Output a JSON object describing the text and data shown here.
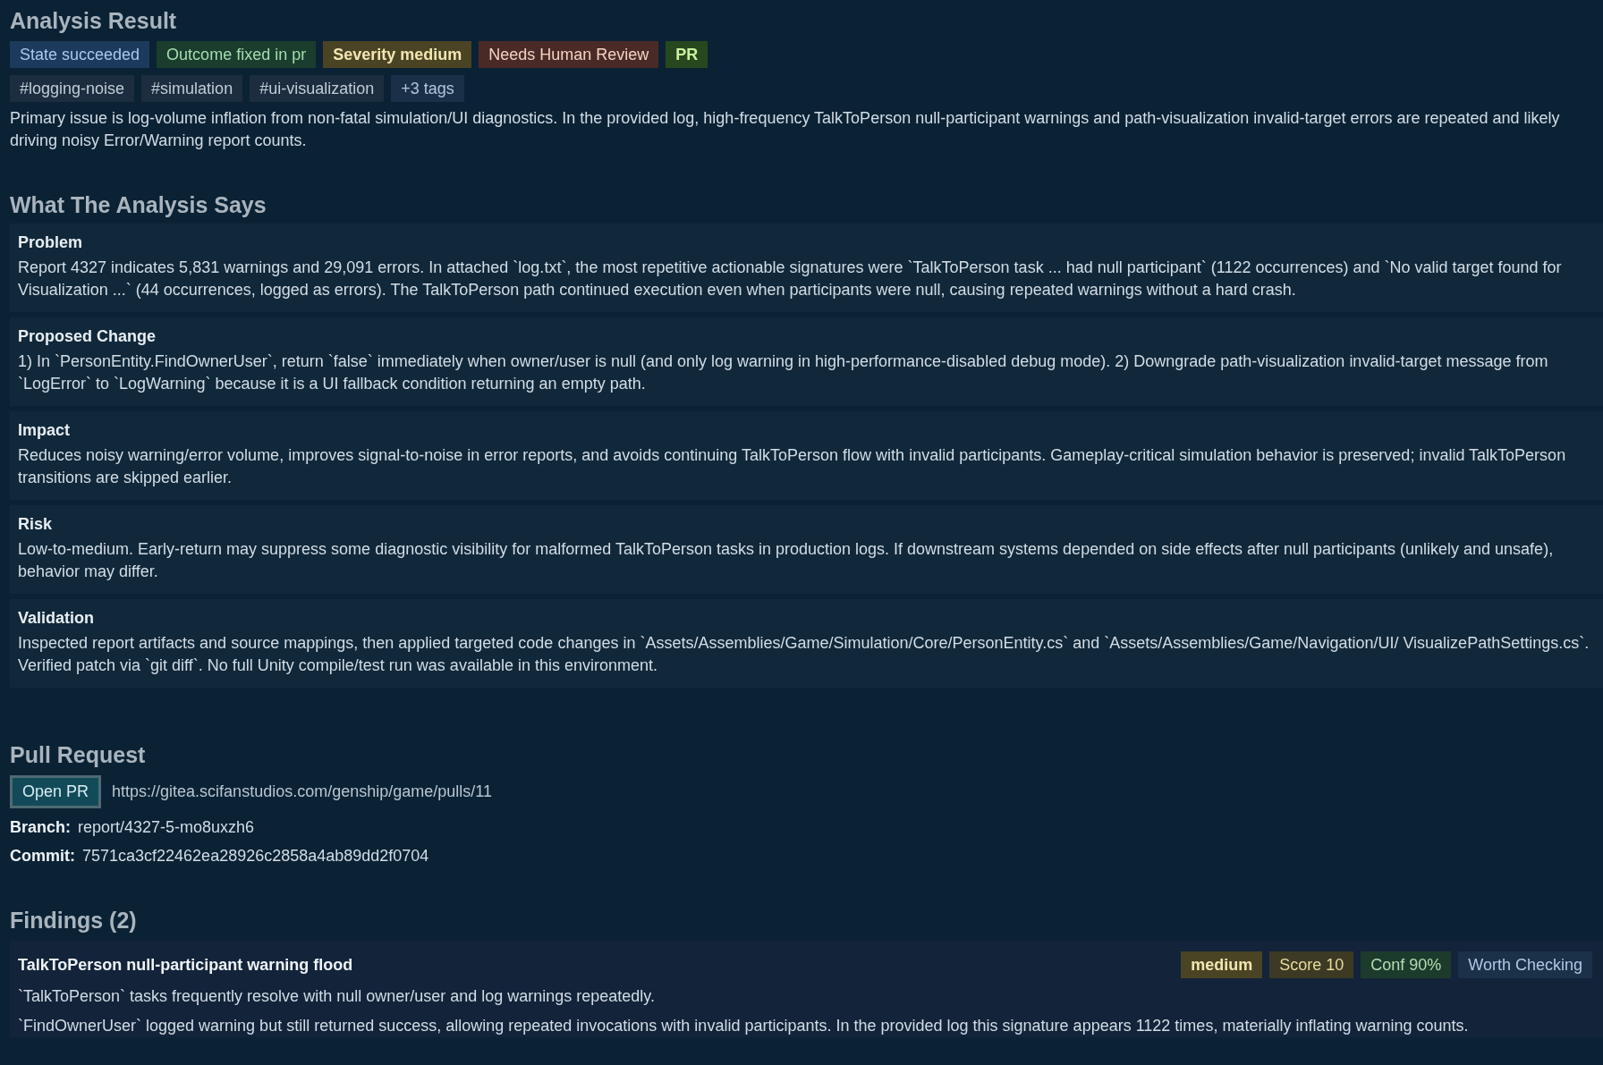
{
  "analysis": {
    "title": "Analysis Result",
    "badges": [
      {
        "label": "State succeeded",
        "kind": "state"
      },
      {
        "label": "Outcome fixed in pr",
        "kind": "outcome"
      },
      {
        "label": "Severity medium",
        "kind": "severity"
      },
      {
        "label": "Needs Human Review",
        "kind": "review"
      },
      {
        "label": "PR",
        "kind": "pr"
      }
    ],
    "tags": [
      {
        "label": "#logging-noise",
        "kind": "tag"
      },
      {
        "label": "#simulation",
        "kind": "tag"
      },
      {
        "label": "#ui-visualization",
        "kind": "tag"
      },
      {
        "label": "+3 tags",
        "kind": "more"
      }
    ],
    "summary": "Primary issue is log-volume inflation from non-fatal simulation/UI diagnostics. In the provided log, high-frequency TalkToPerson null-participant warnings and path-visualization invalid-target errors are repeated and likely driving noisy Error/Warning report counts."
  },
  "what_the_analysis_says": {
    "title": "What The Analysis Says",
    "sections": [
      {
        "heading": "Problem",
        "text": "Report 4327 indicates 5,831 warnings and 29,091 errors. In attached `log.txt`, the most repetitive actionable signatures were `TalkToPerson task ... had null participant` (1122 occurrences) and `No valid target found for Visualization ...` (44 occurrences, logged as errors). The TalkToPerson path continued execution even when participants were null, causing repeated warnings without a hard crash."
      },
      {
        "heading": "Proposed Change",
        "text": "1) In `PersonEntity.FindOwnerUser`, return `false` immediately when owner/user is null (and only log warning in high-performance-disabled debug mode). 2) Downgrade path-visualization invalid-target message from `LogError` to `LogWarning` because it is a UI fallback condition returning an empty path."
      },
      {
        "heading": "Impact",
        "text": "Reduces noisy warning/error volume, improves signal-to-noise in error reports, and avoids continuing TalkToPerson flow with invalid participants. Gameplay-critical simulation behavior is preserved; invalid TalkToPerson transitions are skipped earlier."
      },
      {
        "heading": "Risk",
        "text": "Low-to-medium. Early-return may suppress some diagnostic visibility for malformed TalkToPerson tasks in production logs. If downstream systems depended on side effects after null participants (unlikely and unsafe), behavior may differ."
      },
      {
        "heading": "Validation",
        "text": "Inspected report artifacts and source mappings, then applied targeted code changes in `Assets/Assemblies/Game/Simulation/Core/PersonEntity.cs` and `Assets/Assemblies/Game/Navigation/UI/ VisualizePathSettings.cs`. Verified patch via `git diff`. No full Unity compile/test run was available in this environment."
      }
    ]
  },
  "pull_request": {
    "title": "Pull Request",
    "button": "Open PR",
    "url": "https://gitea.scifanstudios.com/genship/game/pulls/11",
    "fields": [
      {
        "label": "Branch:",
        "value": "report/4327-5-mo8uxzh6"
      },
      {
        "label": "Commit:",
        "value": "7571ca3cf22462ea28926c2858a4ab89dd2f0704"
      }
    ]
  },
  "findings": {
    "title": "Findings (2)",
    "items": [
      {
        "title": "TalkToPerson null-participant warning flood",
        "badges": [
          {
            "label": "medium",
            "kind": "severity"
          },
          {
            "label": "Score 10",
            "kind": "score"
          },
          {
            "label": "Conf 90%",
            "kind": "conf"
          },
          {
            "label": "Worth Checking",
            "kind": "verdict"
          }
        ],
        "summary": "`TalkToPerson` tasks frequently resolve with null owner/user and log warnings repeatedly.",
        "detail": "`FindOwnerUser` logged warning but still returned success, allowing repeated invocations with invalid participants. In the provided log this signature appears 1122 times, materially inflating warning counts."
      }
    ]
  }
}
